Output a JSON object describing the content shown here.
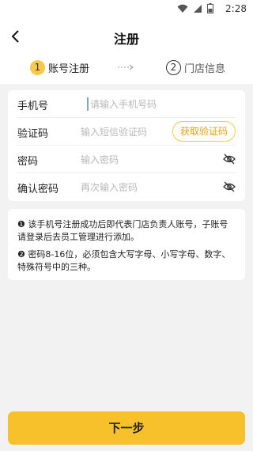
{
  "status": {
    "time": "2:28"
  },
  "header": {
    "title": "注册"
  },
  "steps": [
    {
      "number": "1",
      "label": "账号注册"
    },
    {
      "number": "2",
      "label": "门店信息"
    }
  ],
  "form": {
    "phone": {
      "label": "手机号",
      "placeholder": "请输入手机号码"
    },
    "code": {
      "label": "验证码",
      "placeholder": "输入短信验证码",
      "button": "获取验证码"
    },
    "password": {
      "label": "密码",
      "placeholder": "输入密码"
    },
    "confirm": {
      "label": "确认密码",
      "placeholder": "再次输入密码"
    }
  },
  "notice": {
    "item1": "❶ 该手机号注册成功后即代表门店负责人账号，子账号请登录后去员工管理进行添加。",
    "item2": "❷ 密码8-16位，必须包含大写字母、小写字母、数字、特殊符号中的三种。"
  },
  "footer": {
    "next_label": "下一步"
  },
  "colors": {
    "accent": "#f7c12c",
    "accent_text": "#e4a400"
  }
}
